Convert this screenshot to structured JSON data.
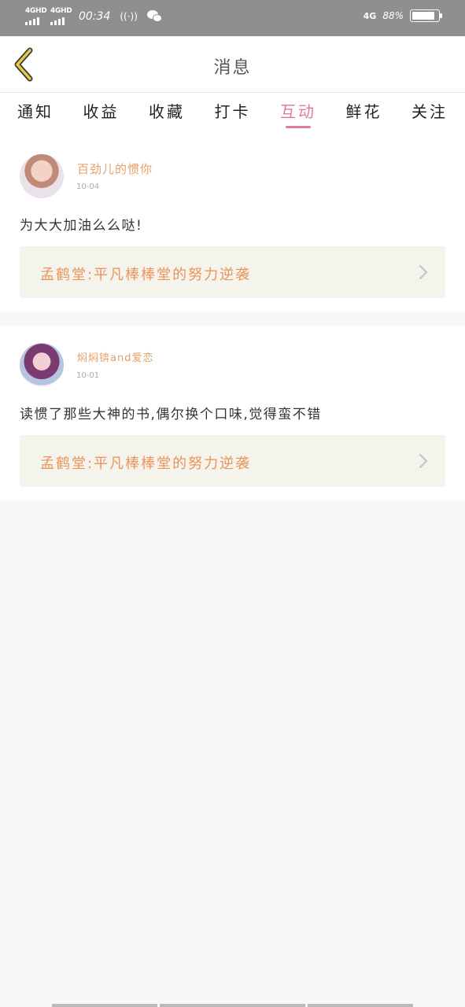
{
  "status_bar": {
    "signal1_label": "4GHD",
    "signal2_label": "4GHD",
    "time": "00:34",
    "hotspot_icon": "hotspot-icon",
    "wechat_icon": "wechat-icon",
    "network_label": "4G",
    "battery_percent": "88%",
    "battery_level": 0.88
  },
  "header": {
    "back_icon": "chevron-left-icon",
    "title": "消息"
  },
  "tabs": [
    {
      "label": "通知"
    },
    {
      "label": "收益"
    },
    {
      "label": "收藏"
    },
    {
      "label": "打卡"
    },
    {
      "label": "互动"
    },
    {
      "label": "鲜花"
    },
    {
      "label": "关注"
    }
  ],
  "active_tab_index": 4,
  "messages": [
    {
      "username": "百劲儿的惯你",
      "date": "10-04",
      "text": "为大大加油么么哒!",
      "book": "孟鹤堂:平凡棒棒堂的努力逆袭"
    },
    {
      "username": "焖焖锛and爱恋",
      "date": "10-01",
      "text": "读惯了那些大神的书,偶尔换个口味,觉得蛮不错",
      "book": "孟鹤堂:平凡棒棒堂的努力逆袭"
    }
  ],
  "colors": {
    "accent_pink": "#e07aa3",
    "username_orange": "#e6a06a",
    "book_orange": "#e9955c",
    "back_yellow": "#e8c94a"
  }
}
